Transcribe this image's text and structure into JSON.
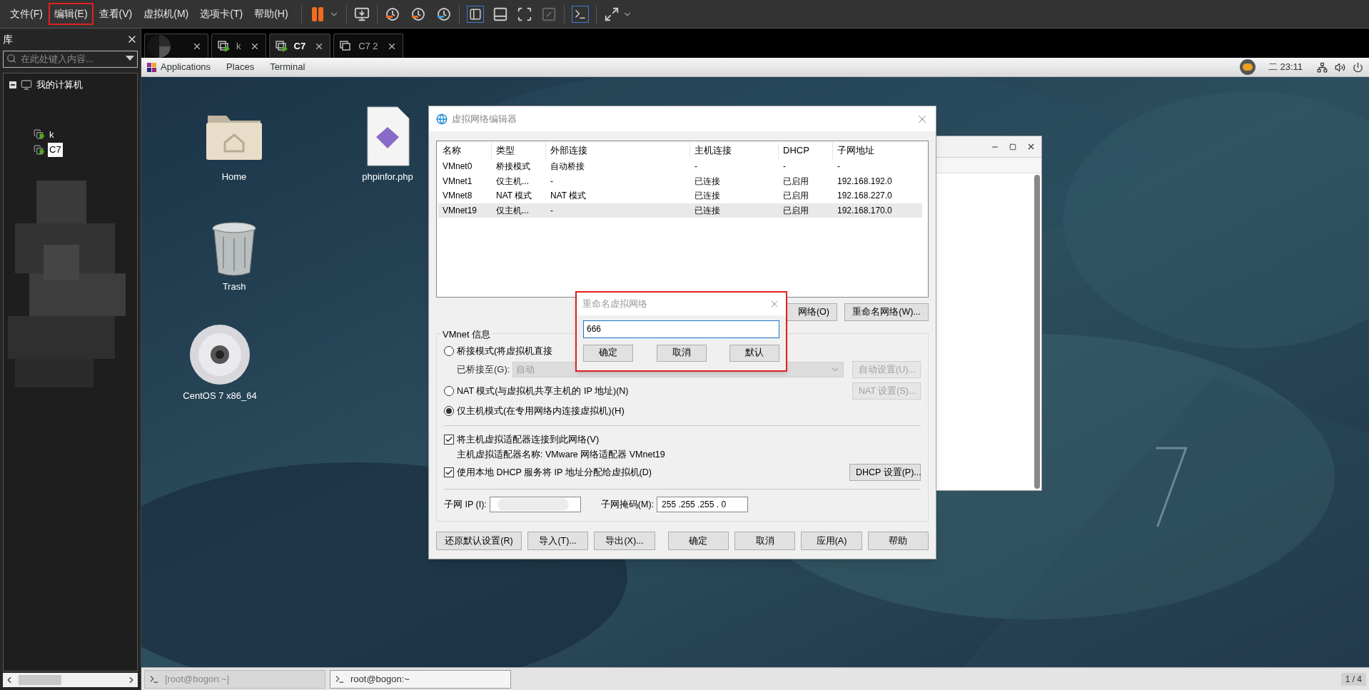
{
  "menubar": {
    "items": [
      {
        "label": "文件(F)",
        "highlighted": false
      },
      {
        "label": "编辑(E)",
        "highlighted": true
      },
      {
        "label": "查看(V)",
        "highlighted": false
      },
      {
        "label": "虚拟机(M)",
        "highlighted": false
      },
      {
        "label": "选项卡(T)",
        "highlighted": false
      },
      {
        "label": "帮助(H)",
        "highlighted": false
      }
    ]
  },
  "library": {
    "title": "库",
    "search": {
      "placeholder": "在此处键入内容..."
    },
    "tree": [
      {
        "label": "我的计算机",
        "expanded": true,
        "children": [
          {
            "label": "k",
            "selected": false
          },
          {
            "label": "C7",
            "selected": true
          }
        ]
      }
    ]
  },
  "tabs": [
    {
      "selected": false
    },
    {
      "label": "k",
      "selected": false,
      "running": true
    },
    {
      "label": "C7",
      "selected": true,
      "running": true
    },
    {
      "label": "C7 2",
      "selected": false,
      "running": false
    }
  ],
  "guest_topbar": {
    "menus": [
      "Applications",
      "Places",
      "Terminal"
    ],
    "clock": "二 23:11"
  },
  "desktop_icons": [
    {
      "kind": "folder",
      "label": "Home"
    },
    {
      "kind": "trash",
      "label": "Trash"
    },
    {
      "kind": "disc",
      "label": "CentOS 7 x86_64"
    },
    {
      "kind": "file",
      "label": "phpinfor.php"
    }
  ],
  "network_editor": {
    "title": "虚拟网络编辑器",
    "columns": [
      "名称",
      "类型",
      "外部连接",
      "主机连接",
      "DHCP",
      "子网地址"
    ],
    "rows": [
      {
        "cells": [
          "VMnet0",
          "桥接模式",
          "自动桥接",
          "-",
          "-",
          "-"
        ],
        "selected": false
      },
      {
        "cells": [
          "VMnet1",
          "仅主机...",
          "-",
          "已连接",
          "已启用",
          "192.168.192.0"
        ],
        "selected": false
      },
      {
        "cells": [
          "VMnet8",
          "NAT 模式",
          "NAT 模式",
          "已连接",
          "已启用",
          "192.168.227.0"
        ],
        "selected": false
      },
      {
        "cells": [
          "VMnet19",
          "仅主机...",
          "-",
          "已连接",
          "已启用",
          "192.168.170.0"
        ],
        "selected": true
      }
    ],
    "list_buttons": [
      "网络(O)",
      "重命名网络(W)..."
    ],
    "group_title": "VMnet 信息",
    "modes": [
      {
        "label": "桥接模式(将虚拟机直接",
        "selected": false
      },
      {
        "label": "NAT 模式(与虚拟机共享主机的 IP 地址)(N)",
        "selected": false,
        "button": {
          "label": "NAT 设置(S)...",
          "disabled": true
        }
      },
      {
        "label": "仅主机模式(在专用网络内连接虚拟机)(H)",
        "selected": true
      }
    ],
    "bridged_to": {
      "label": "已桥接至(G):",
      "value": "自动",
      "disabled": true,
      "button": {
        "label": "自动设置(U)...",
        "disabled": true
      }
    },
    "connect_adapter": {
      "label": "将主机虚拟适配器连接到此网络(V)",
      "checked": true
    },
    "adapter_name": "主机虚拟适配器名称: VMware 网络适配器 VMnet19",
    "use_dhcp": {
      "label": "使用本地 DHCP 服务将 IP 地址分配给虚拟机(D)",
      "checked": true,
      "button": {
        "label": "DHCP 设置(P)...",
        "disabled": false
      }
    },
    "subnet_ip_label": "子网 IP (I):",
    "subnet_mask": {
      "label": "子网掩码(M):",
      "value": "255 .255 .255 . 0"
    },
    "footer_buttons": [
      "还原默认设置(R)",
      "导入(T)...",
      "导出(X)...",
      "确定",
      "取消",
      "应用(A)",
      "帮助"
    ]
  },
  "rename_dialog": {
    "title": "重命名虚拟网络",
    "value": "666",
    "buttons": [
      "确定",
      "取消",
      "默认"
    ]
  },
  "taskbar": {
    "items": [
      {
        "label": "[root@bogon:~]",
        "selected": false
      },
      {
        "label": "root@bogon:~",
        "selected": true
      }
    ],
    "workspace": "1 / 4"
  }
}
